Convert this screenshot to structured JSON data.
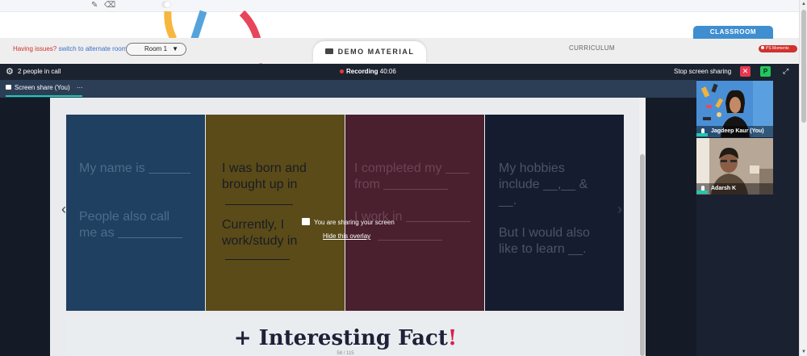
{
  "toolbar": {
    "icons": [
      "pencil-icon",
      "eraser-icon"
    ]
  },
  "header": {
    "issues_text": "Having issues?",
    "issues_link": "switch to alternate room",
    "room_select": "Room 1",
    "demo_tab": "DEMO MATERIAL",
    "curriculum_tab": "CURRICULUM",
    "classroom_tab": "CLASSROOM",
    "ps_badge": "PS Moments"
  },
  "call_bar": {
    "people": "2 people in call",
    "recording_label": "Recording",
    "recording_time": "40:06",
    "stop_share": "Stop screen sharing",
    "p_button": "P"
  },
  "share": {
    "tab_label": "Screen share (You)",
    "tab_menu": "···",
    "overlay_text": "You are sharing your screen",
    "overlay_link": "Hide this overlay"
  },
  "slide": {
    "card1": {
      "line1": "My name is",
      "line2": "People also call",
      "line3": "me as"
    },
    "card2": {
      "line1": "I was born and",
      "line2": "brought up in",
      "line3": "Currently, I",
      "line4": "work/study in"
    },
    "card3": {
      "line1": "I completed my",
      "line2": "from",
      "line3": "I work in"
    },
    "card4": {
      "line1": "My hobbies",
      "line2": "include __,__ &",
      "line3": "__.",
      "line4": "But I would also",
      "line5": "like to learn __."
    },
    "fact_plus": "+ Interesting Fact",
    "fact_bang": "!",
    "page_no": "58 / 115"
  },
  "participants": [
    {
      "name": "Jagdeep Kaur (You)"
    },
    {
      "name": "Adarsh K"
    }
  ],
  "colors": {
    "call_bar": "#1c2330",
    "card_blue": "#1f4060",
    "card_yellow": "#5a4b19",
    "card_red": "#4a1f2e",
    "card_navy": "#161c2f",
    "accent_teal": "#1fc8b0",
    "classroom_blue": "#3e8ed0"
  }
}
